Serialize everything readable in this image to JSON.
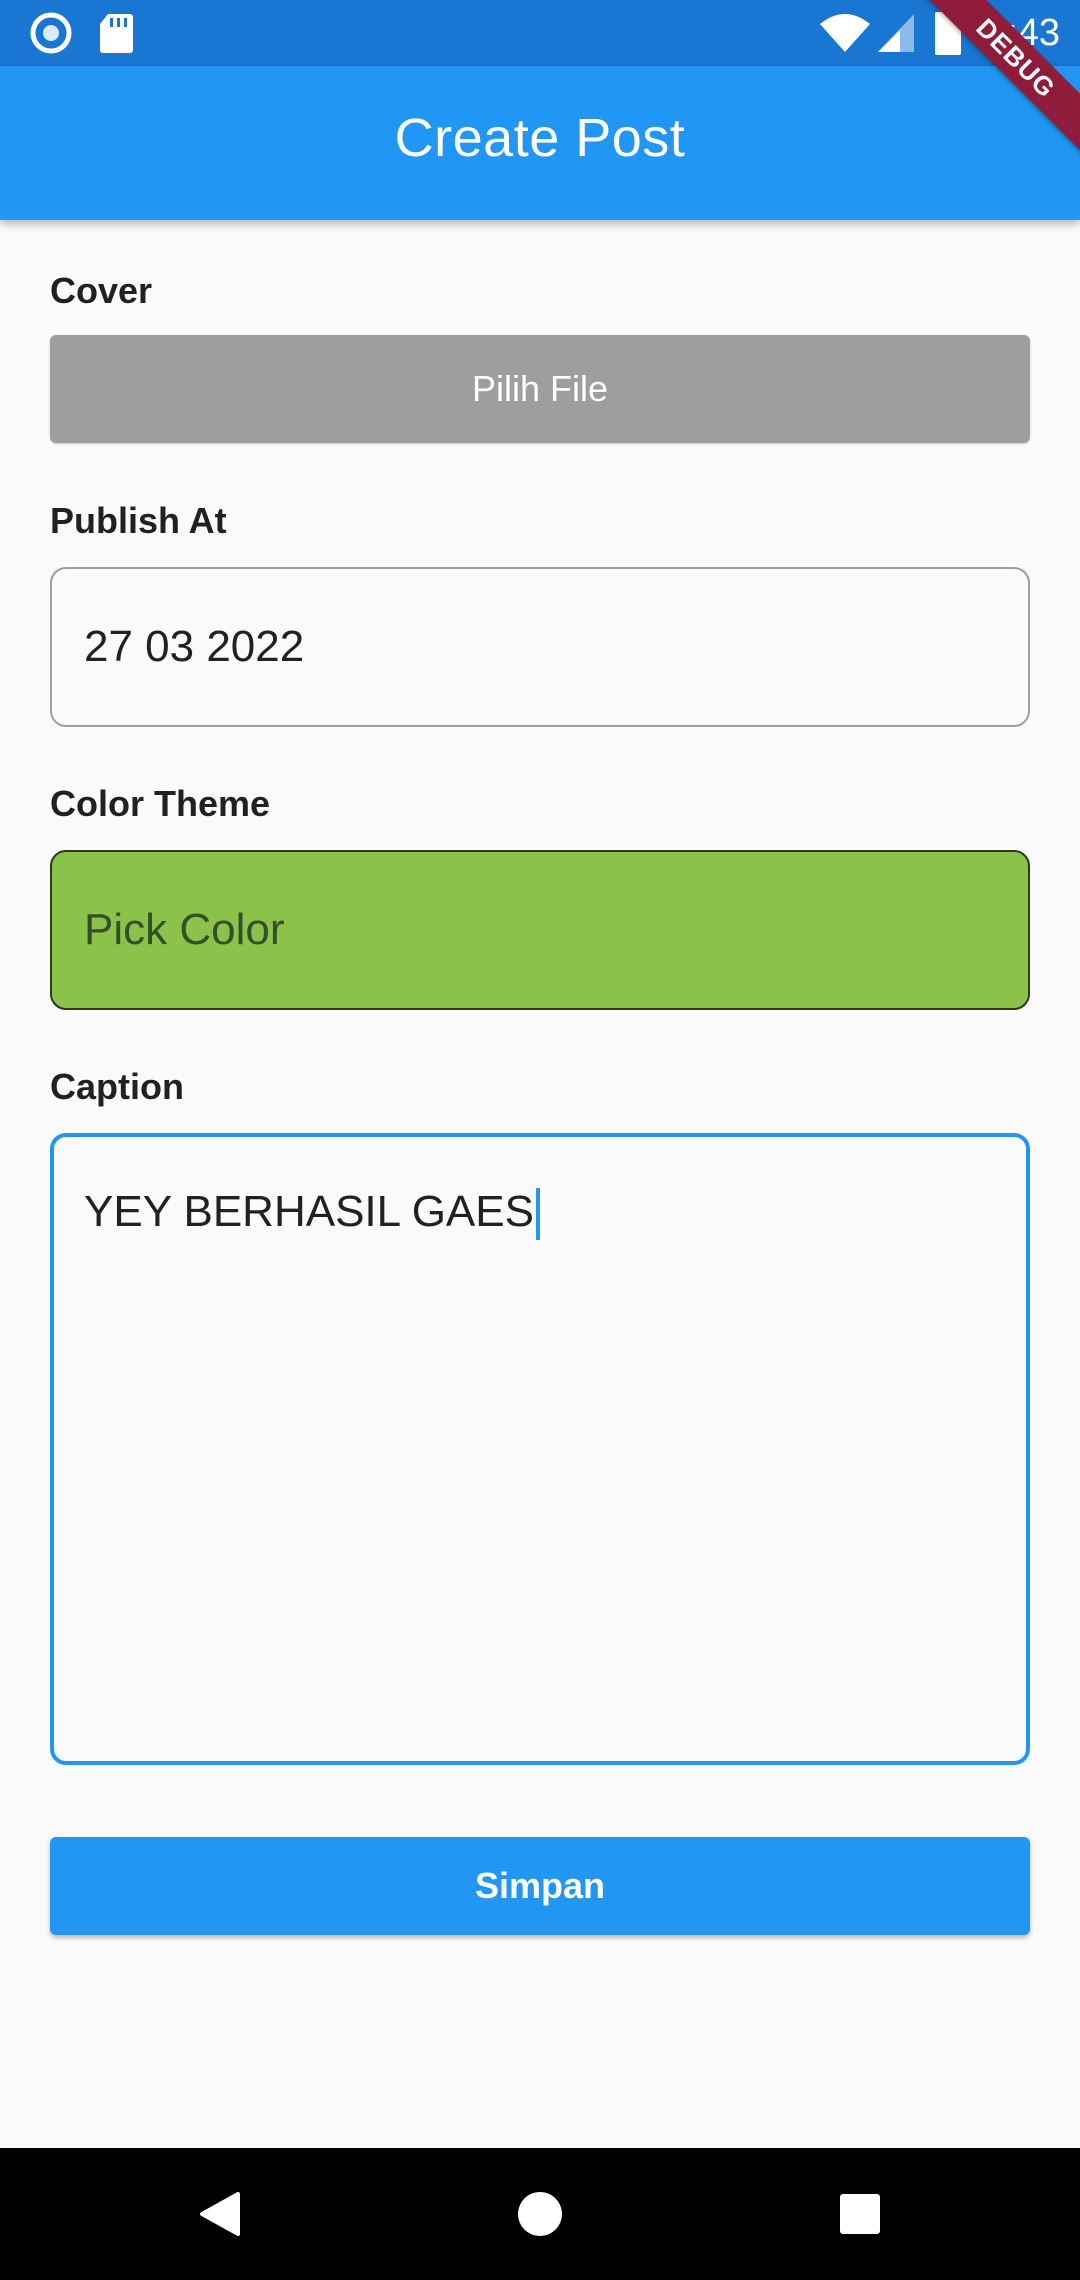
{
  "status_bar": {
    "time": "7:43",
    "icons": [
      "record-icon",
      "sd-card-icon",
      "wifi-icon",
      "signal-icon",
      "battery-icon"
    ]
  },
  "debug_banner": "DEBUG",
  "app_bar": {
    "title": "Create Post"
  },
  "form": {
    "cover": {
      "label": "Cover",
      "button_label": "Pilih File"
    },
    "publish_at": {
      "label": "Publish At",
      "value": "27 03 2022"
    },
    "color_theme": {
      "label": "Color Theme",
      "value": "Pick Color",
      "selected_color": "#8bc34a"
    },
    "caption": {
      "label": "Caption",
      "value": "YEY BERHASIL GAES"
    },
    "submit_label": "Simpan"
  },
  "nav_bar": {
    "icons": [
      "back-icon",
      "home-icon",
      "recents-icon"
    ]
  },
  "colors": {
    "primary": "#2196f3",
    "status_bar": "#1976d2",
    "file_button": "#9e9e9e"
  }
}
